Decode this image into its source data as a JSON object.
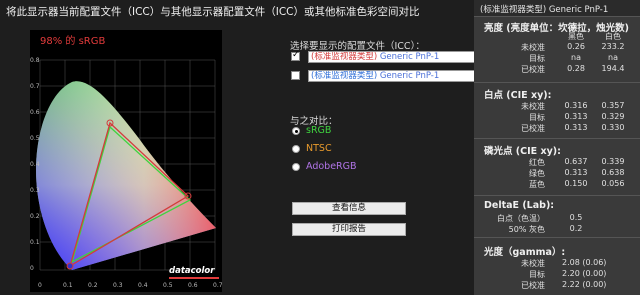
{
  "window_title": "将此显示器当前配置文件（ICC）与其他显示器配置文件（ICC）或其他标准色彩空间对比",
  "chart": {
    "coverage_label": "98% 的 sRGB",
    "logo_text": "datacolor",
    "x_ticks": [
      "0",
      "0.1",
      "0.2",
      "0.3",
      "0.4",
      "0.5",
      "0.6",
      "0.7"
    ],
    "y_ticks": [
      "0.8",
      "0.7",
      "0.6",
      "0.5",
      "0.4",
      "0.3",
      "0.2",
      "0.1",
      "0"
    ]
  },
  "compare": {
    "select_label": "选择要显示的配置文件（ICC）：",
    "profiles": [
      {
        "checked": true,
        "name": "(标准监视器类型)",
        "hint": "Generic PnP-1",
        "name_color": "#d33b3b"
      },
      {
        "checked": false,
        "name": "(标准监视器类型)",
        "hint": "Generic PnP-1",
        "name_color": "#2f6fd8"
      }
    ],
    "compare_label": "与之对比：",
    "standards": [
      {
        "label": "sRGB",
        "color": "#3fd33f",
        "selected": true
      },
      {
        "label": "NTSC",
        "color": "#e89a2c",
        "selected": false
      },
      {
        "label": "AdobeRGB",
        "color": "#b074e6",
        "selected": false
      }
    ],
    "view_info_button": "查看信息",
    "print_report_button": "打印报告"
  },
  "panel": {
    "header": "(标准监视器类型)  Generic PnP-1",
    "luminance": {
      "title": "亮度 (亮度单位：坎德拉，烛光数)",
      "col_black": "黑色",
      "col_white": "白色",
      "rows": [
        {
          "label": "未校准",
          "a": "0.26",
          "b": "233.2"
        },
        {
          "label": "目标",
          "a": "na",
          "b": "na"
        },
        {
          "label": "已校准",
          "a": "0.28",
          "b": "194.4"
        }
      ]
    },
    "white_point": {
      "title": "白点 (CIE xy):",
      "rows": [
        {
          "label": "未校准",
          "a": "0.316",
          "b": "0.357"
        },
        {
          "label": "目标",
          "a": "0.313",
          "b": "0.329"
        },
        {
          "label": "已校准",
          "a": "0.313",
          "b": "0.330"
        }
      ]
    },
    "phosphors": {
      "title": "磷光点 (CIE xy):",
      "rows": [
        {
          "label": "红色",
          "a": "0.637",
          "b": "0.339"
        },
        {
          "label": "绿色",
          "a": "0.313",
          "b": "0.638"
        },
        {
          "label": "蓝色",
          "a": "0.150",
          "b": "0.056"
        }
      ]
    },
    "delta_e": {
      "title": "DeltaE (Lab):",
      "rows": [
        {
          "label": "白点（色温）",
          "a": "0.5"
        },
        {
          "label": "50% 灰色",
          "a": "0.2"
        }
      ]
    },
    "gamma": {
      "title": "光度（gamma）:",
      "rows": [
        {
          "label": "未校准",
          "a": "2.08 (0.06)"
        },
        {
          "label": "目标",
          "a": "2.20 (0.00)"
        },
        {
          "label": "已校准",
          "a": "2.22 (0.00)"
        }
      ]
    }
  }
}
